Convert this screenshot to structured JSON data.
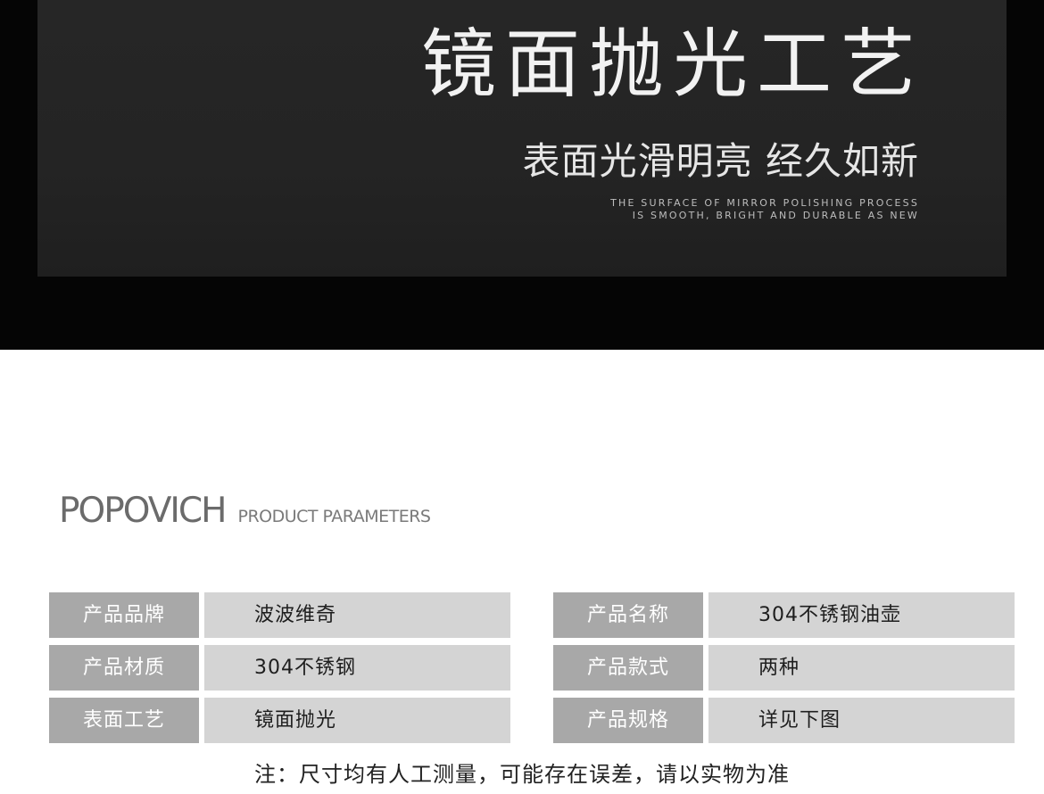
{
  "hero": {
    "title": "镜面抛光工艺",
    "subtitle": "表面光滑明亮 经久如新",
    "english_line1": "THE SURFACE OF MIRROR POLISHING PROCESS",
    "english_line2": "IS SMOOTH, BRIGHT AND DURABLE AS NEW"
  },
  "params": {
    "brand": "POPOVICH",
    "heading": "PRODUCT PARAMETERS",
    "left": [
      {
        "key": "产品品牌",
        "value": "波波维奇"
      },
      {
        "key": "产品材质",
        "value": "304不锈钢"
      },
      {
        "key": "表面工艺",
        "value": "镜面抛光"
      }
    ],
    "right": [
      {
        "key": "产品名称",
        "value": "304不锈钢油壶"
      },
      {
        "key": "产品款式",
        "value": "两种"
      },
      {
        "key": "产品规格",
        "value": "详见下图"
      }
    ]
  },
  "note": "注：尺寸均有人工测量，可能存在误差，请以实物为准",
  "colors": {
    "hero_bg": "#050505",
    "hero_panel": "#262626",
    "key_cell": "#a8a8a8",
    "value_cell": "#d4d4d4"
  }
}
